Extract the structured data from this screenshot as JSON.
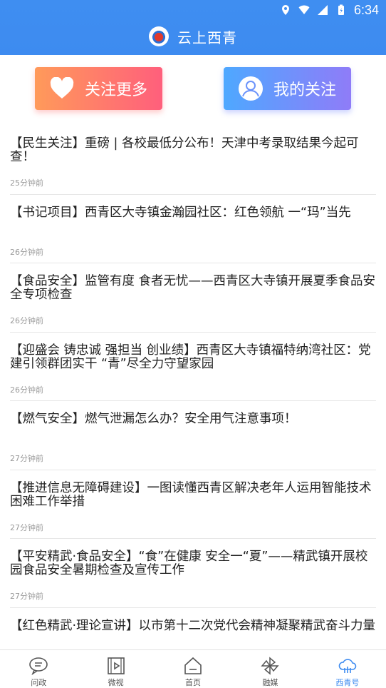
{
  "status_bar": {
    "time": "6:34"
  },
  "header": {
    "title": "云上西青"
  },
  "actions": {
    "follow_more": "关注更多",
    "my_follow": "我的关注"
  },
  "news": [
    {
      "title": "【民生关注】重磅 | 各校最低分公布！天津中考录取结果今起可查！",
      "time": "25分钟前"
    },
    {
      "title": "【书记项目】西青区大寺镇金瀚园社区：红色领航 一“玛”当先",
      "time": "26分钟前"
    },
    {
      "title": "【食品安全】监管有度 食者无忧——西青区大寺镇开展夏季食品安全专项检查",
      "time": "26分钟前"
    },
    {
      "title": "【迎盛会 铸忠诚 强担当 创业绩】西青区大寺镇福特纳湾社区：党建引领群团实干 “青”尽全力守望家园",
      "time": "26分钟前"
    },
    {
      "title": "【燃气安全】燃气泄漏怎么办？安全用气注意事项！",
      "time": "27分钟前"
    },
    {
      "title": "【推进信息无障碍建设】一图读懂西青区解决老年人运用智能技术困难工作举措",
      "time": "27分钟前"
    },
    {
      "title": "【平安精武·食品安全】“食”在健康 安全一“夏”——精武镇开展校园食品安全暑期检查及宣传工作",
      "time": "27分钟前"
    },
    {
      "title": "【红色精武·理论宣讲】以市第十二次党代会精神凝聚精武奋斗力量",
      "time": ""
    }
  ],
  "nav": [
    {
      "label": "问政",
      "icon": "chat-icon"
    },
    {
      "label": "微视",
      "icon": "video-icon"
    },
    {
      "label": "首页",
      "icon": "home-icon"
    },
    {
      "label": "融媒",
      "icon": "pinwheel-icon"
    },
    {
      "label": "西青号",
      "icon": "cloud-icon"
    }
  ],
  "colors": {
    "header": "#3d8bf0",
    "active": "#3d8bf0",
    "follow_more": "#ff6f76",
    "my_follow": "#6b93fb"
  }
}
